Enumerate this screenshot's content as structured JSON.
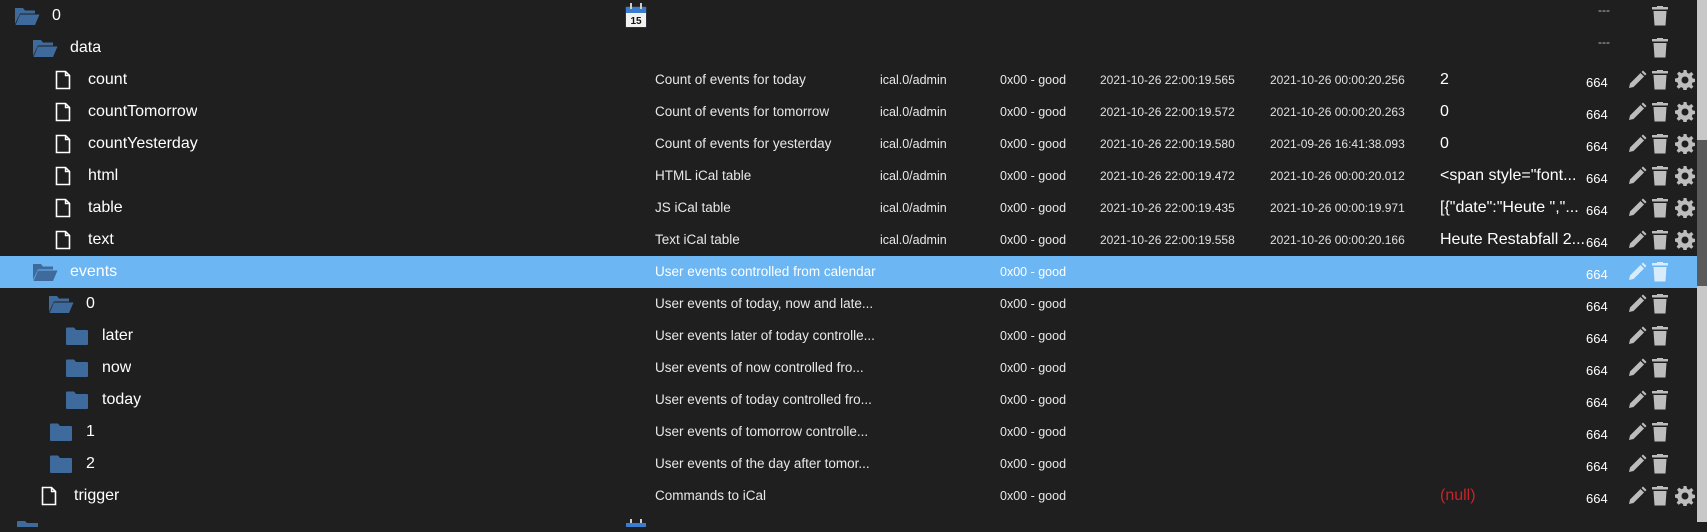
{
  "colors": {
    "background": "#1f1f1f",
    "selected_row": "#6cb6f4",
    "folder_icon": "#3f6b9c",
    "null_value": "#c8232b",
    "action_icon": "#bdbdbd"
  },
  "rows": [
    {
      "name": "0",
      "icon": "folder-open-icon",
      "description": "",
      "role": "",
      "status": "",
      "ts": "",
      "lc": "",
      "value": "",
      "acl": "---",
      "actions": [
        "delete"
      ],
      "calendar_icon": true
    },
    {
      "name": "data",
      "icon": "folder-open-icon",
      "description": "",
      "role": "",
      "status": "",
      "ts": "",
      "lc": "",
      "value": "",
      "acl": "---",
      "actions": [
        "delete"
      ]
    },
    {
      "name": "count",
      "icon": "file-icon",
      "description": "Count of events for today",
      "role": "ical.0/admin",
      "status": "0x00 - good",
      "ts": "2021-10-26 22:00:19.565",
      "lc": "2021-10-26 00:00:20.256",
      "value": "2",
      "acl": "664",
      "actions": [
        "edit",
        "delete",
        "settings"
      ]
    },
    {
      "name": "countTomorrow",
      "icon": "file-icon",
      "description": "Count of events for tomorrow",
      "role": "ical.0/admin",
      "status": "0x00 - good",
      "ts": "2021-10-26 22:00:19.572",
      "lc": "2021-10-26 00:00:20.263",
      "value": "0",
      "acl": "664",
      "actions": [
        "edit",
        "delete",
        "settings"
      ]
    },
    {
      "name": "countYesterday",
      "icon": "file-icon",
      "description": "Count of events for yesterday",
      "role": "ical.0/admin",
      "status": "0x00 - good",
      "ts": "2021-10-26 22:00:19.580",
      "lc": "2021-09-26 16:41:38.093",
      "value": "0",
      "acl": "664",
      "actions": [
        "edit",
        "delete",
        "settings"
      ]
    },
    {
      "name": "html",
      "icon": "file-icon",
      "description": "HTML iCal table",
      "role": "ical.0/admin",
      "status": "0x00 - good",
      "ts": "2021-10-26 22:00:19.472",
      "lc": "2021-10-26 00:00:20.012",
      "value": "<span style=\"font...",
      "acl": "664",
      "actions": [
        "edit",
        "delete",
        "settings"
      ]
    },
    {
      "name": "table",
      "icon": "file-icon",
      "description": "JS iCal table",
      "role": "ical.0/admin",
      "status": "0x00 - good",
      "ts": "2021-10-26 22:00:19.435",
      "lc": "2021-10-26 00:00:19.971",
      "value": "[{\"date\":\"Heute \",\"...",
      "acl": "664",
      "actions": [
        "edit",
        "delete",
        "settings"
      ]
    },
    {
      "name": "text",
      "icon": "file-icon",
      "description": "Text iCal table",
      "role": "ical.0/admin",
      "status": "0x00 - good",
      "ts": "2021-10-26 22:00:19.558",
      "lc": "2021-10-26 00:00:20.166",
      "value": "Heute Restabfall 2...",
      "acl": "664",
      "actions": [
        "edit",
        "delete",
        "settings"
      ]
    },
    {
      "name": "events",
      "icon": "folder-open-icon",
      "description": "User events controlled from calendar",
      "role": "",
      "status": "0x00 - good",
      "ts": "",
      "lc": "",
      "value": "",
      "acl": "664",
      "actions": [
        "edit",
        "delete"
      ],
      "selected": true
    },
    {
      "name": "0",
      "icon": "folder-open-icon",
      "description": "User events of today, now and late...",
      "role": "",
      "status": "0x00 - good",
      "ts": "",
      "lc": "",
      "value": "",
      "acl": "664",
      "actions": [
        "edit",
        "delete"
      ]
    },
    {
      "name": "later",
      "icon": "folder-icon",
      "description": "User events later of today controlle...",
      "role": "",
      "status": "0x00 - good",
      "ts": "",
      "lc": "",
      "value": "",
      "acl": "664",
      "actions": [
        "edit",
        "delete"
      ]
    },
    {
      "name": "now",
      "icon": "folder-icon",
      "description": "User events of now controlled fro...",
      "role": "",
      "status": "0x00 - good",
      "ts": "",
      "lc": "",
      "value": "",
      "acl": "664",
      "actions": [
        "edit",
        "delete"
      ]
    },
    {
      "name": "today",
      "icon": "folder-icon",
      "description": "User events of today controlled fro...",
      "role": "",
      "status": "0x00 - good",
      "ts": "",
      "lc": "",
      "value": "",
      "acl": "664",
      "actions": [
        "edit",
        "delete"
      ]
    },
    {
      "name": "1",
      "icon": "folder-icon",
      "description": "User events of tomorrow controlle...",
      "role": "",
      "status": "0x00 - good",
      "ts": "",
      "lc": "",
      "value": "",
      "acl": "664",
      "actions": [
        "edit",
        "delete"
      ]
    },
    {
      "name": "2",
      "icon": "folder-icon",
      "description": "User events of the day after tomor...",
      "role": "",
      "status": "0x00 - good",
      "ts": "",
      "lc": "",
      "value": "",
      "acl": "664",
      "actions": [
        "edit",
        "delete"
      ]
    },
    {
      "name": "trigger",
      "icon": "file-icon",
      "description": "Commands to iCal",
      "role": "",
      "status": "0x00 - good",
      "ts": "",
      "lc": "",
      "value": "(null)",
      "value_is_null": true,
      "acl": "664",
      "actions": [
        "edit",
        "delete",
        "settings"
      ]
    }
  ]
}
